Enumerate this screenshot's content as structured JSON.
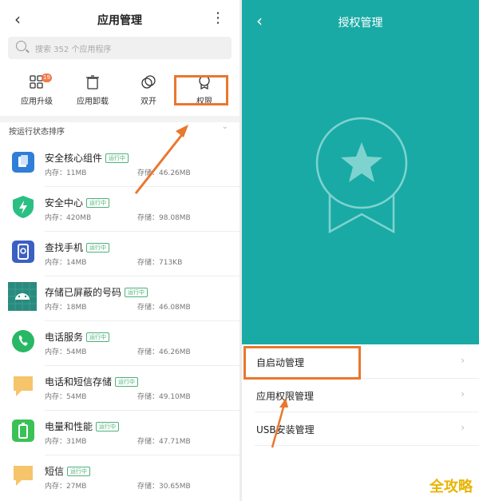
{
  "left_panel": {
    "title": "应用管理",
    "search_placeholder": "搜索 352 个应用程序",
    "quick_actions": [
      {
        "label": "应用升级",
        "badge": "19",
        "icon": "app-upgrade-icon"
      },
      {
        "label": "应用卸载",
        "icon": "trash-icon"
      },
      {
        "label": "双开",
        "icon": "dual-app-icon"
      },
      {
        "label": "权限",
        "icon": "permission-medal-icon"
      }
    ],
    "sort_label": "按运行状态排序",
    "apps": [
      {
        "name": "安全核心组件",
        "status": "运行中",
        "memory": "内存：11MB",
        "storage": "存储：46.26MB",
        "icon_color": "#2f7ed8"
      },
      {
        "name": "安全中心",
        "status": "运行中",
        "memory": "内存：420MB",
        "storage": "存储：98.08MB",
        "icon_color": "#2bbf84"
      },
      {
        "name": "查找手机",
        "status": "运行中",
        "memory": "内存：14MB",
        "storage": "存储：713KB",
        "icon_color": "#3b60c4"
      },
      {
        "name": "存储已屏蔽的号码",
        "status": "运行中",
        "memory": "内存：18MB",
        "storage": "存储：46.08MB",
        "icon_color": "#2b8a7e"
      },
      {
        "name": "电话服务",
        "status": "运行中",
        "memory": "内存：54MB",
        "storage": "存储：46.26MB",
        "icon_color": "#28b865"
      },
      {
        "name": "电话和短信存储",
        "status": "运行中",
        "memory": "内存：54MB",
        "storage": "存储：49.10MB",
        "icon_color": "#f6c46a"
      },
      {
        "name": "电量和性能",
        "status": "运行中",
        "memory": "内存：31MB",
        "storage": "存储：47.71MB",
        "icon_color": "#3ac257"
      },
      {
        "name": "短信",
        "status": "运行中",
        "memory": "内存：27MB",
        "storage": "存储：30.65MB",
        "icon_color": "#f6c46a"
      }
    ]
  },
  "right_panel": {
    "title": "授权管理",
    "menu": [
      {
        "label": "自启动管理"
      },
      {
        "label": "应用权限管理"
      },
      {
        "label": "USB安装管理"
      }
    ]
  },
  "watermark": "全攻略",
  "colors": {
    "accent": "#1aaaa6",
    "highlight": "#e9772e",
    "status_green": "#4db27a"
  }
}
